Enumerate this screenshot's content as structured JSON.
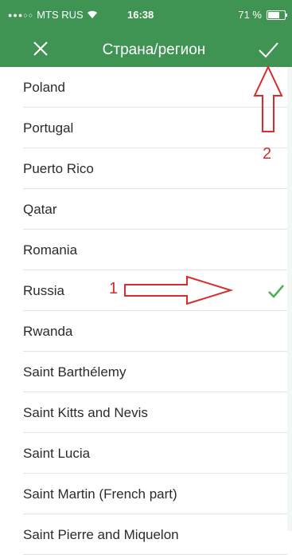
{
  "status": {
    "carrier": "MTS RUS",
    "time": "16:38",
    "battery": "71 %",
    "battery_level": 0.71
  },
  "nav": {
    "title": "Страна/регион"
  },
  "countries": [
    {
      "label": "Poland",
      "selected": false
    },
    {
      "label": "Portugal",
      "selected": false
    },
    {
      "label": "Puerto Rico",
      "selected": false
    },
    {
      "label": "Qatar",
      "selected": false
    },
    {
      "label": "Romania",
      "selected": false
    },
    {
      "label": "Russia",
      "selected": true
    },
    {
      "label": "Rwanda",
      "selected": false
    },
    {
      "label": "Saint Barthélemy",
      "selected": false
    },
    {
      "label": "Saint Kitts and Nevis",
      "selected": false
    },
    {
      "label": "Saint Lucia",
      "selected": false
    },
    {
      "label": "Saint Martin (French part)",
      "selected": false
    },
    {
      "label": "Saint Pierre and Miquelon",
      "selected": false
    }
  ],
  "annotations": {
    "label_1": "1",
    "label_2": "2"
  },
  "colors": {
    "header_green": "#3f9353",
    "check_green": "#4caf50",
    "annotation_red": "#d62d2d"
  }
}
